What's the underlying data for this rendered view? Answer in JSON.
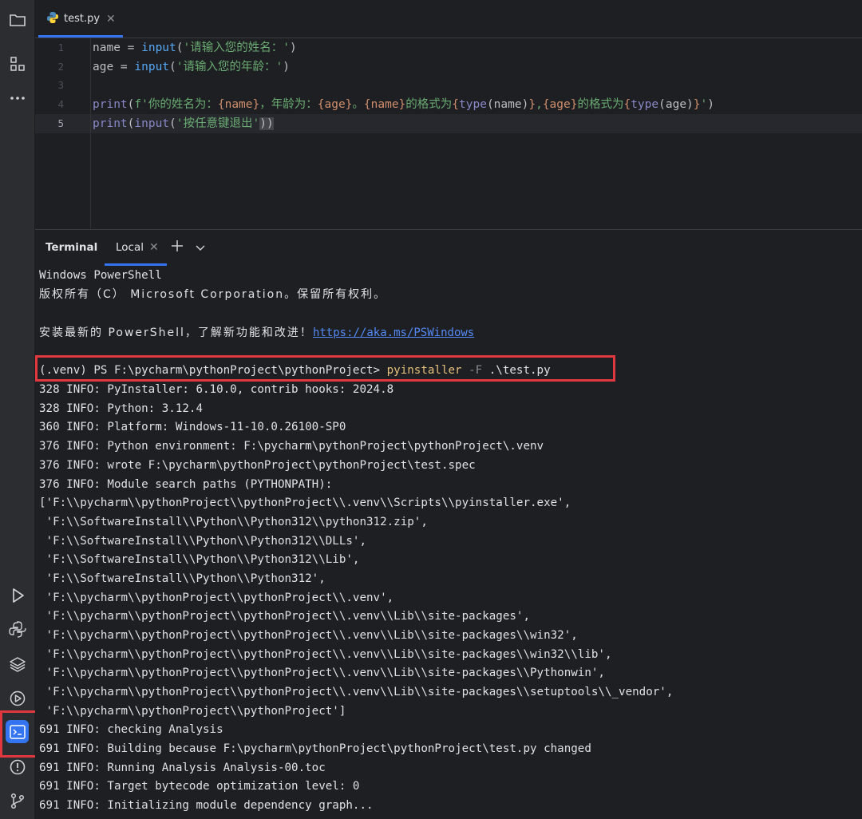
{
  "editor": {
    "tab": {
      "filename": "test.py"
    },
    "line_numbers": [
      "1",
      "2",
      "3",
      "4",
      "5"
    ],
    "lines": [
      {
        "p1": "name = ",
        "fn": "input",
        "op": "(",
        "str": "'请输入您的姓名：'",
        "cp": ")"
      },
      {
        "p1": "age = ",
        "fn": "input",
        "op": "(",
        "str": "'请输入您的年龄：'",
        "cp": ")"
      },
      {},
      {
        "fn": "print",
        "op": "(",
        "s1": "f'你的姓名为：",
        "b1": "{name}",
        "s2": "，年龄为：",
        "b2": "{age}",
        "s3": "。",
        "b3": "{name}",
        "s4": "的格式为",
        "b4o": "{",
        "b4f": "type",
        "b4a": "(name)",
        "b4c": "}",
        "s5": ",",
        "b5": "{age}",
        "s6": "的格式为",
        "b6o": "{",
        "b6f": "type",
        "b6a": "(age)",
        "b6c": "}",
        "s7": "'",
        "cp": ")"
      },
      {
        "fn": "print",
        "op": "(",
        "fn2": "input",
        "op2": "(",
        "str": "'按任意键退出'",
        "cp2": ")",
        "cp": ")"
      }
    ]
  },
  "terminal": {
    "title": "Terminal",
    "tab_label": "Local",
    "lines": [
      "Windows PowerShell",
      "版权所有（C） Microsoft Corporation。保留所有权利。",
      "",
      "",
      "",
      "",
      "328 INFO: PyInstaller: 6.10.0, contrib hooks: 2024.8",
      "328 INFO: Python: 3.12.4",
      "360 INFO: Platform: Windows-11-10.0.26100-SP0",
      "376 INFO: Python environment: F:\\pycharm\\pythonProject\\pythonProject\\.venv",
      "376 INFO: wrote F:\\pycharm\\pythonProject\\pythonProject\\test.spec",
      "376 INFO: Module search paths (PYTHONPATH):",
      "['F:\\\\pycharm\\\\pythonProject\\\\pythonProject\\\\.venv\\\\Scripts\\\\pyinstaller.exe',",
      " 'F:\\\\SoftwareInstall\\\\Python\\\\Python312\\\\python312.zip',",
      " 'F:\\\\SoftwareInstall\\\\Python\\\\Python312\\\\DLLs',",
      " 'F:\\\\SoftwareInstall\\\\Python\\\\Python312\\\\Lib',",
      " 'F:\\\\SoftwareInstall\\\\Python\\\\Python312',",
      " 'F:\\\\pycharm\\\\pythonProject\\\\pythonProject\\\\.venv',",
      " 'F:\\\\pycharm\\\\pythonProject\\\\pythonProject\\\\.venv\\\\Lib\\\\site-packages',",
      " 'F:\\\\pycharm\\\\pythonProject\\\\pythonProject\\\\.venv\\\\Lib\\\\site-packages\\\\win32',",
      " 'F:\\\\pycharm\\\\pythonProject\\\\pythonProject\\\\.venv\\\\Lib\\\\site-packages\\\\win32\\\\lib',",
      " 'F:\\\\pycharm\\\\pythonProject\\\\pythonProject\\\\.venv\\\\Lib\\\\site-packages\\\\Pythonwin',",
      " 'F:\\\\pycharm\\\\pythonProject\\\\pythonProject\\\\.venv\\\\Lib\\\\site-packages\\\\setuptools\\\\_vendor',",
      " 'F:\\\\pycharm\\\\pythonProject\\\\pythonProject']",
      "691 INFO: checking Analysis",
      "691 INFO: Building because F:\\pycharm\\pythonProject\\pythonProject\\test.py changed",
      "691 INFO: Running Analysis Analysis-00.toc",
      "691 INFO: Target bytecode optimization level: 0",
      "691 INFO: Initializing module dependency graph..."
    ],
    "update_line": {
      "text": "安装最新的 PowerShell，了解新功能和改进！",
      "link": "https://aka.ms/PSWindows"
    },
    "command_line": {
      "prompt": "(.venv) PS F:\\pycharm\\pythonProject\\pythonProject> ",
      "cmd": "pyinstaller",
      "flag": " -F",
      "arg": " .\\test.py"
    }
  },
  "toolstrip": {
    "icons": [
      "folder-icon",
      "structure-icon",
      "more-icon",
      "run-icon",
      "python-console-icon",
      "layers-icon",
      "services-icon",
      "terminal-icon",
      "problems-icon",
      "git-icon"
    ],
    "active": "terminal-icon"
  },
  "colors": {
    "background": "#1e1f22",
    "accent": "#3574f0",
    "highlight_box": "#e0383e"
  }
}
